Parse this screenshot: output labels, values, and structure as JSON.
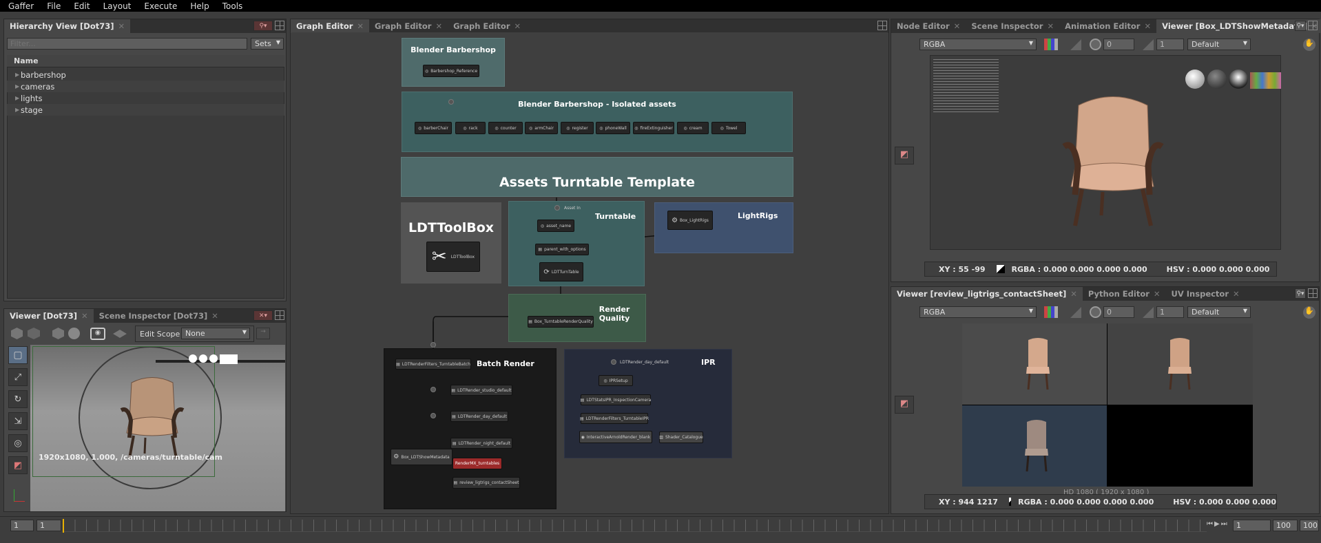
{
  "menu": [
    "Gaffer",
    "File",
    "Edit",
    "Layout",
    "Execute",
    "Help",
    "Tools"
  ],
  "hierarchy": {
    "tab": "Hierarchy View [Dot73]",
    "filter_placeholder": "Filter...",
    "sets_label": "Sets",
    "column": "Name",
    "items": [
      "barbershop",
      "cameras",
      "lights",
      "stage"
    ]
  },
  "viewer_left": {
    "tabs": [
      "Viewer [Dot73]",
      "Scene Inspector [Dot73]"
    ],
    "edit_scope_label": "Edit Scope",
    "edit_scope_value": "None",
    "status": "1920x1080, 1.000, /cameras/turntable/cam"
  },
  "graph_tabs": [
    "Graph Editor",
    "Graph Editor",
    "Graph Editor"
  ],
  "graph": {
    "backdrops": {
      "blender_barbershop": "Blender Barbershop",
      "isolated": "Blender Barbershop - Isolated assets",
      "template": "Assets Turntable Template",
      "toolbox": "LDTToolBox",
      "turntable": "Turntable",
      "lightrigs": "LightRigs",
      "render_quality": "Render Quality",
      "batch_render": "Batch Render",
      "ipr": "IPR"
    },
    "nodes": {
      "barbershop_ref": "Barbershop_Reference",
      "isolated": [
        "barberChair",
        "rack",
        "counter",
        "armChair",
        "register",
        "phoneWall",
        "fireExtinguisher",
        "cream",
        "Towel"
      ],
      "toolbox_node": "LDTToolBox",
      "asset_in": "Asset In",
      "asset_name": "asset_name",
      "parent_with_options": "parent_with_options",
      "ldtturntable": "LDTTurnTable",
      "box_lightrigs": "Box_LightRigs",
      "render_quality_node": "Box_TurntableRenderQuality",
      "batch_filter": "LDTRenderFilters_TurntableBatch",
      "studio": "LDTRender_studio_default",
      "day": "LDTRender_day_default",
      "night": "LDTRender_night_default",
      "show_metadata": "Box_LDTShowMetadata",
      "rendermax": "RenderMX_turntables",
      "contact": "review_ligtrigs_contactSheet",
      "ipr_day": "LDTRender_day_default",
      "ipr_setup": "IPRSetup",
      "ldtstats": "LDTStatsIPR_InspectionCamera",
      "ipr_filter": "LDTRenderFilters_TurntableIPR",
      "interactive": "InteractiveArnoldRender_blank",
      "shader_catalogue": "Shader_Catalogue"
    }
  },
  "right_top": {
    "tabs": [
      "Node Editor",
      "Scene Inspector",
      "Animation Editor",
      "Viewer [Box_LDTShowMetadata]"
    ],
    "channel": "RGBA",
    "exposure": "0",
    "gamma": "1",
    "display": "Default",
    "readout": {
      "xy": "XY : 55 -99",
      "rgba": "RGBA : 0.000 0.000 0.000 0.000",
      "hsv": "HSV : 0.000 0.000 0.000"
    }
  },
  "right_bottom": {
    "tabs": [
      "Viewer [review_ligtrigs_contactSheet]",
      "Python Editor",
      "UV Inspector"
    ],
    "channel": "RGBA",
    "exposure": "0",
    "gamma": "1",
    "display": "Default",
    "format": "HD 1080 ( 1920 x 1080 )",
    "readout": {
      "xy": "XY : 944 1217",
      "rgba": "RGBA : 0.000 0.000 0.000 0.000",
      "hsv": "HSV : 0.000 0.000 0.000"
    }
  },
  "timeline": {
    "start": "1",
    "current": "1",
    "current_right": "1",
    "end": "100",
    "end2": "100"
  },
  "colors": {
    "turntable_bg": "#3d6060",
    "lightrigs_bg": "#3f516e",
    "render_quality_bg": "#3d5a48",
    "batch_bg": "#1a1a1a",
    "ipr_bg": "#262b3a",
    "rendermax": "#9b2a2a"
  }
}
